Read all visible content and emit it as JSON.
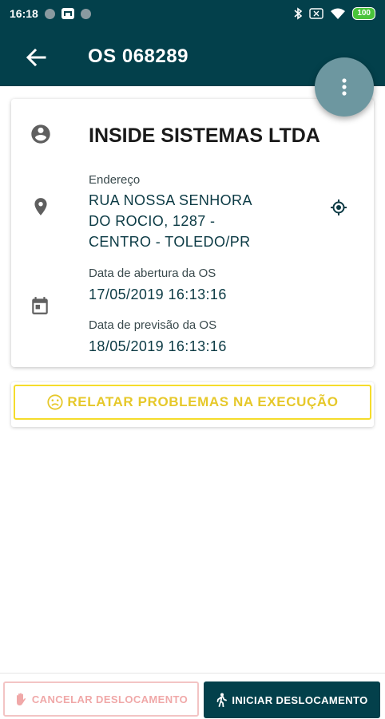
{
  "status_bar": {
    "time": "16:18",
    "battery": "100"
  },
  "app_bar": {
    "title": "OS 068289"
  },
  "details": {
    "company": "INSIDE SISTEMAS LTDA",
    "address_label": "Endereço",
    "address_lines": [
      "RUA NOSSA SENHORA",
      "DO ROCIO, 1287 -",
      "CENTRO - TOLEDO/PR"
    ],
    "opening_label": "Data de abertura da OS",
    "opening_value": "17/05/2019 16:13:16",
    "forecast_label": "Data de previsão da OS",
    "forecast_value": "18/05/2019 16:13:16"
  },
  "actions": {
    "report_label": "RELATAR PROBLEMAS NA EXECUÇÃO",
    "cancel_label": "CANCELAR DESLOCAMENTO",
    "start_label": "INICIAR DESLOCAMENTO"
  },
  "colors": {
    "primary": "#03404b",
    "fab": "#6d97a0",
    "warning": "#f5dc2b",
    "cancel": "#f0a8a8"
  },
  "icons": {
    "back": "arrow-back-icon",
    "menu": "more-vert-icon",
    "company": "account-circle-icon",
    "address": "location-pin-icon",
    "locate": "my-location-icon",
    "date": "calendar-icon",
    "report": "sad-face-icon",
    "cancel": "hand-stop-icon",
    "start": "walking-icon"
  }
}
